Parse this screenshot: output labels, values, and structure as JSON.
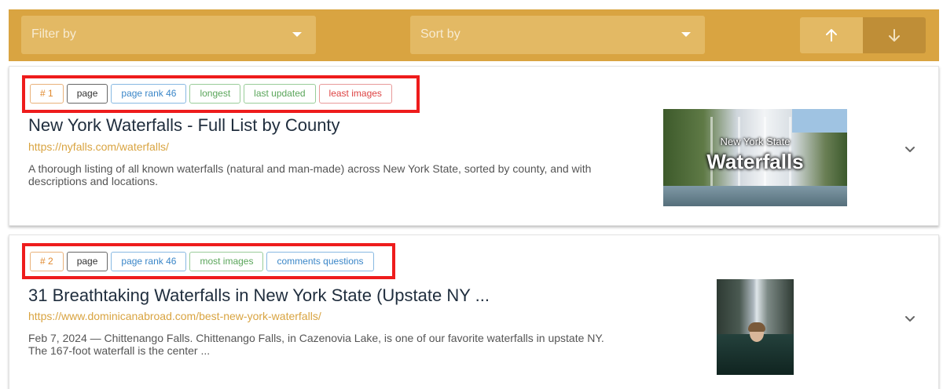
{
  "toolbar": {
    "filter_placeholder": "Filter by",
    "sort_placeholder": "Sort by",
    "sort_asc_icon": "arrow-up-icon",
    "sort_desc_icon": "arrow-down-icon",
    "colors": {
      "bar": "#d9a441",
      "active_sort": "#bf8e37"
    }
  },
  "results": [
    {
      "tags": [
        "# 1",
        "page",
        "page rank 46",
        "longest",
        "last updated",
        "least images"
      ],
      "title": "New York Waterfalls - Full List by County",
      "url": "https://nyfalls.com/waterfalls/",
      "description": "A thorough listing of all known waterfalls (natural and man-made) across New York State, sorted by county, and with descriptions and locations.",
      "thumbnail_text": {
        "line1": "New York State",
        "line2": "Waterfalls"
      }
    },
    {
      "tags": [
        "# 2",
        "page",
        "page rank 46",
        "most images",
        "comments questions"
      ],
      "title": "31 Breathtaking Waterfalls in New York State (Upstate NY ...",
      "url": "https://www.dominicanabroad.com/best-new-york-waterfalls/",
      "description": "Feb 7, 2024 — Chittenango Falls. Chittenango Falls, in Cazenovia Lake, is one of our favorite waterfalls in upstate NY. The 167-foot waterfall is the center ..."
    }
  ],
  "highlight_color": "#ee1c1c",
  "link_color": "#d9a441"
}
